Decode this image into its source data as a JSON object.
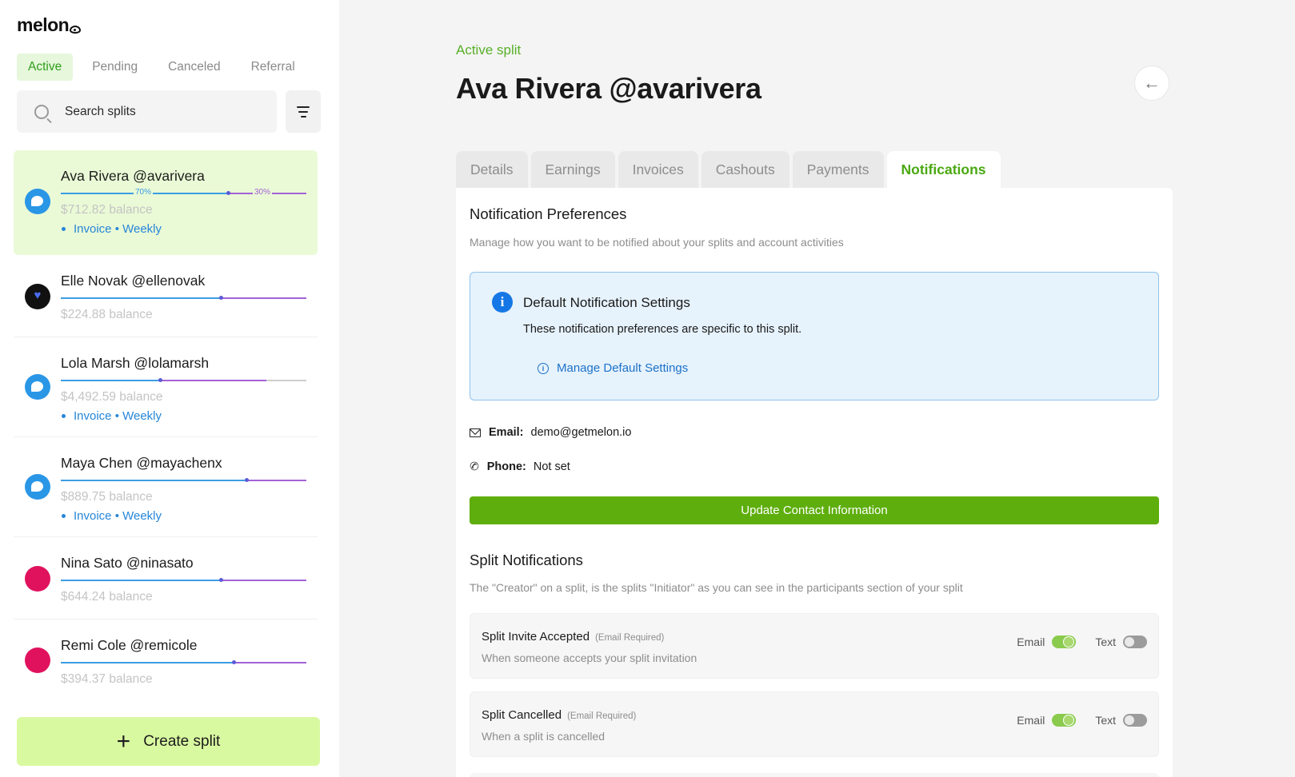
{
  "brand": {
    "name": "melon"
  },
  "sidebar": {
    "status_tabs": [
      {
        "label": "Active",
        "active": true
      },
      {
        "label": "Pending",
        "active": false
      },
      {
        "label": "Canceled",
        "active": false
      },
      {
        "label": "Referral",
        "active": false
      }
    ],
    "search": {
      "placeholder": "Search splits",
      "value": ""
    },
    "splits": [
      {
        "name": "Ava Rivera @avarivera",
        "balance": "$712.82 balance",
        "meta": "Invoice • Weekly",
        "avatar": "blue",
        "left_pct_label": "70%",
        "right_pct_label": "30%",
        "active": true
      },
      {
        "name": "Elle Novak @ellenovak",
        "balance": "$224.88 balance",
        "meta": "",
        "avatar": "black",
        "active": false
      },
      {
        "name": "Lola Marsh @lolamarsh",
        "balance": "$4,492.59 balance",
        "meta": "Invoice • Weekly",
        "avatar": "blue",
        "active": false
      },
      {
        "name": "Maya Chen @mayachenx",
        "balance": "$889.75 balance",
        "meta": "Invoice • Weekly",
        "avatar": "blue",
        "active": false
      },
      {
        "name": "Nina Sato @ninasato",
        "balance": "$644.24 balance",
        "meta": "",
        "avatar": "pink",
        "active": false
      },
      {
        "name": "Remi Cole @remicole",
        "balance": "$394.37 balance",
        "meta": "",
        "avatar": "pink",
        "active": false
      }
    ],
    "create_label": "Create split"
  },
  "header": {
    "eyebrow": "Active split",
    "title": "Ava Rivera @avarivera",
    "back_icon": "arrow-left-icon"
  },
  "tabs": [
    {
      "label": "Details",
      "active": false
    },
    {
      "label": "Earnings",
      "active": false
    },
    {
      "label": "Invoices",
      "active": false
    },
    {
      "label": "Cashouts",
      "active": false
    },
    {
      "label": "Payments",
      "active": false
    },
    {
      "label": "Notifications",
      "active": true
    }
  ],
  "notifications": {
    "title": "Notification Preferences",
    "description": "Manage how you want to be notified about your splits and account activities",
    "info": {
      "title": "Default Notification Settings",
      "text": "These notification preferences are specific to this split.",
      "link": "Manage Default Settings"
    },
    "contact": {
      "email_label": "Email:",
      "email_value": "demo@getmelon.io",
      "phone_label": "Phone:",
      "phone_value": "Not set"
    },
    "update_button": "Update Contact Information",
    "split_section": {
      "title": "Split Notifications",
      "description": "The \"Creator\" on a split, is the splits \"Initiator\" as you can see in the participants section of your split"
    },
    "rows": [
      {
        "title": "Split Invite Accepted",
        "required": "(Email Required)",
        "description": "When someone accepts your split invitation",
        "email_label": "Email",
        "email_on": true,
        "text_label": "Text",
        "text_on": false
      },
      {
        "title": "Split Cancelled",
        "required": "(Email Required)",
        "description": "When a split is cancelled",
        "email_label": "Email",
        "email_on": true,
        "text_label": "Text",
        "text_on": false
      }
    ]
  },
  "colors": {
    "accent_green": "#5eae0d",
    "active_tab_green": "#4aa812",
    "active_card_bg": "#eafad6",
    "info_blue": "#1577e6",
    "link_blue": "#2686d8",
    "create_bg": "#d9f9a1"
  }
}
